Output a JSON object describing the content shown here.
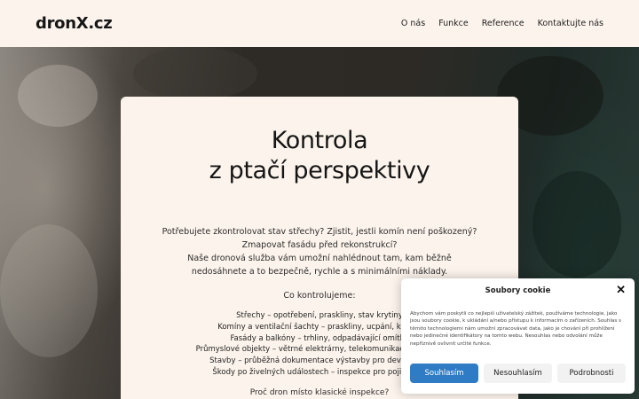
{
  "header": {
    "logo": "dronX.cz",
    "nav": [
      "O nás",
      "Funkce",
      "Reference",
      "Kontaktujte nás"
    ]
  },
  "hero": {
    "title_line1": "Kontrola",
    "title_line2": "z ptačí perspektivy",
    "intro_lines": [
      "Potřebujete zkontrolovat stav střechy? Zjistit, jestli komín není poškozený?",
      "Zmapovat fasádu před rekonstrukcí?",
      "Naše dronová služba vám umožní nahlédnout tam, kam běžně",
      "nedosáhnete a to bezpečně, rychle a s minimálními náklady."
    ],
    "list_heading": "Co kontrolujeme:",
    "list": [
      "Střechy – opotřebení, praskliny, stav krytiny",
      "Komíny a ventilační šachty – praskliny, ucpání, koroze",
      "Fasády a balkóny – trhliny, odpadávající omítka",
      "Průmyslové objekty – větrné elektrárny, telekomunikační stožáry,",
      "Stavby – průběžná dokumentace výstavby pro developery",
      "Škody po živelných událostech – inspekce pro pojišťovny"
    ],
    "why": "Proč dron místo klasické inspekce?"
  },
  "cookie": {
    "title": "Soubory cookie",
    "text": "Abychom vám poskytli co nejlepší uživatelský zážitek, používáme technologie, jako jsou soubory cookie, k ukládání a/nebo přístupu k informacím o zařízeních. Souhlas s těmito technologiemi nám umožní zpracovávat data, jako je chování při prohlížení nebo jedinečné identifikátory na tomto webu. Nesouhlas nebo odvolání může nepříznivě ovlivnit určité funkce.",
    "accept": "Souhlasím",
    "deny": "Nesouhlasím",
    "prefs": "Podrobnosti",
    "close_icon": "close-icon",
    "accent": "#2f7cc4"
  }
}
